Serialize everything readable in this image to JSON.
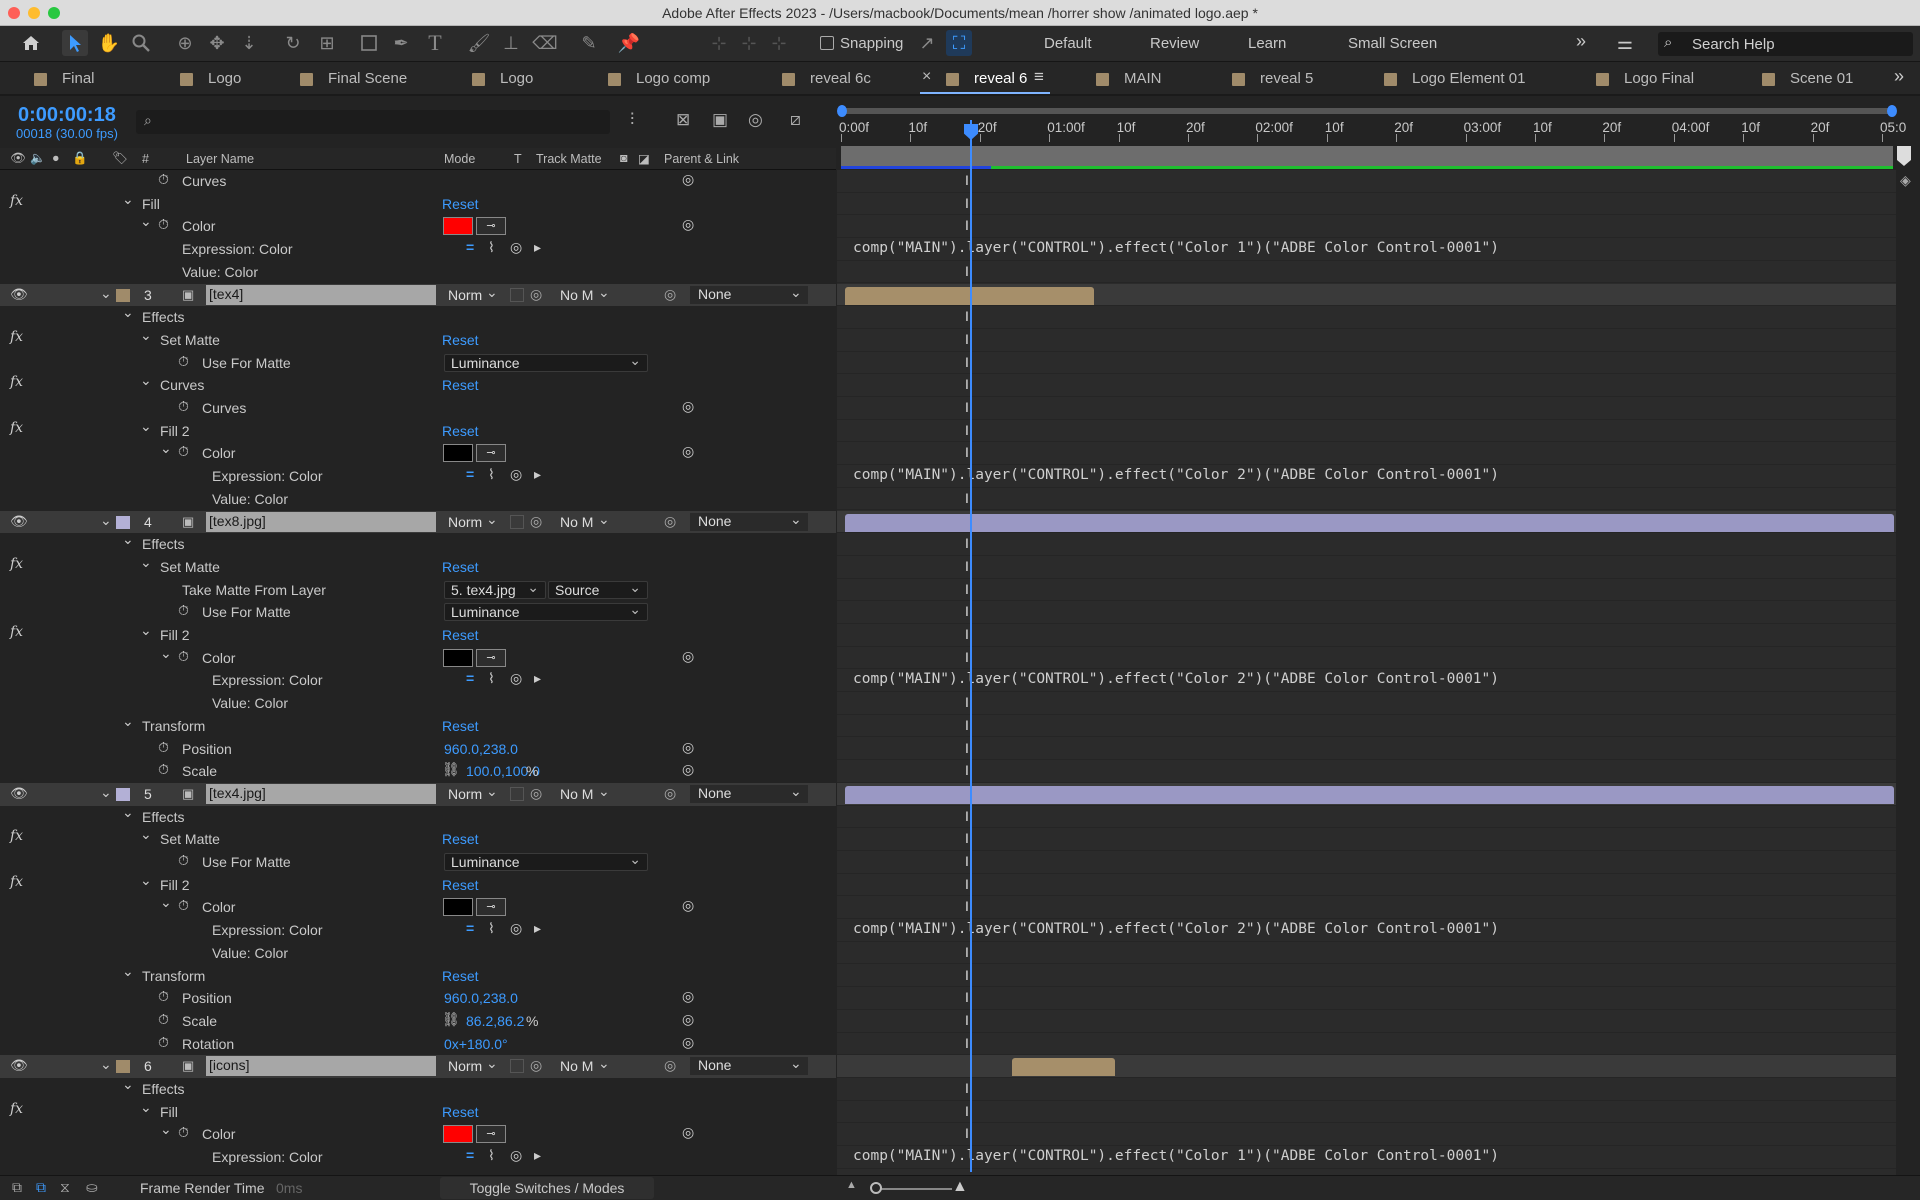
{
  "window": {
    "title": "Adobe After Effects 2023 - /Users/macbook/Documents/mean /horrer show /animated logo.aep *"
  },
  "toolbar": {
    "snapping_label": "Snapping",
    "workspaces": [
      "Default",
      "Review",
      "Learn",
      "Small Screen"
    ],
    "search_placeholder": "Search Help"
  },
  "tabs": [
    {
      "label": "Final"
    },
    {
      "label": "Logo"
    },
    {
      "label": "Final Scene"
    },
    {
      "label": "Logo"
    },
    {
      "label": "Logo comp"
    },
    {
      "label": "reveal 6c"
    },
    {
      "label": "reveal 6",
      "active": true
    },
    {
      "label": "MAIN"
    },
    {
      "label": "reveal 5"
    },
    {
      "label": "Logo Element 01"
    },
    {
      "label": "Logo Final"
    },
    {
      "label": "Scene 01"
    }
  ],
  "comp": {
    "timecode": "0:00:00:18",
    "frame_info": "00018 (30.00 fps)"
  },
  "columns": {
    "num": "#",
    "layer_name": "Layer Name",
    "mode": "Mode",
    "t": "T",
    "track_matte": "Track Matte",
    "parent": "Parent & Link"
  },
  "ruler": {
    "ticks": [
      "0:00f",
      "10f",
      "20f",
      "01:00f",
      "10f",
      "20f",
      "02:00f",
      "10f",
      "20f",
      "03:00f",
      "10f",
      "20f",
      "04:00f",
      "10f",
      "20f",
      "05:0"
    ]
  },
  "rows": [
    {
      "type": "prop",
      "indent": 2,
      "label": "Curves",
      "sw": true
    },
    {
      "type": "effect",
      "indent": 1,
      "label": "Fill",
      "reset": "Reset",
      "fx": true
    },
    {
      "type": "color",
      "indent": 2,
      "label": "Color",
      "swatch": "#ff0000",
      "sw": true
    },
    {
      "type": "expr",
      "indent": 3,
      "label": "Expression: Color",
      "expr": "comp(\"MAIN\").layer(\"CONTROL\").effect(\"Color 1\")(\"ADBE Color Control-0001\")"
    },
    {
      "type": "plain",
      "indent": 3,
      "label": "Value: Color"
    },
    {
      "type": "layer",
      "num": "3",
      "name": "[tex4]",
      "label_color": "#a08b6a",
      "mode": "Norm",
      "matte": "No M",
      "parent": "None",
      "bar": {
        "start": 0,
        "end": 0.237,
        "color": "#a68f6a"
      }
    },
    {
      "type": "group",
      "indent": 1,
      "label": "Effects"
    },
    {
      "type": "effect",
      "indent": 2,
      "label": "Set Matte",
      "reset": "Reset",
      "fx": true
    },
    {
      "type": "dd",
      "indent": 3,
      "label": "Use For Matte",
      "value": "Luminance"
    },
    {
      "type": "effect",
      "indent": 2,
      "label": "Curves",
      "reset": "Reset",
      "fx": true
    },
    {
      "type": "prop",
      "indent": 3,
      "label": "Curves",
      "sw": true
    },
    {
      "type": "effect",
      "indent": 2,
      "label": "Fill 2",
      "reset": "Reset",
      "fx": true
    },
    {
      "type": "color",
      "indent": 3,
      "label": "Color",
      "swatch": "#000000",
      "sw": true
    },
    {
      "type": "expr",
      "indent": 4,
      "label": "Expression: Color",
      "expr": "comp(\"MAIN\").layer(\"CONTROL\").effect(\"Color 2\")(\"ADBE Color Control-0001\")"
    },
    {
      "type": "plain",
      "indent": 4,
      "label": "Value: Color"
    },
    {
      "type": "layer",
      "num": "4",
      "name": "[tex8.jpg]",
      "label_color": "#b3b0d6",
      "mode": "Norm",
      "matte": "No M",
      "parent": "None",
      "bar": {
        "start": 0,
        "end": 1,
        "color": "#9a98c4"
      }
    },
    {
      "type": "group",
      "indent": 1,
      "label": "Effects"
    },
    {
      "type": "effect",
      "indent": 2,
      "label": "Set Matte",
      "reset": "Reset",
      "fx": true
    },
    {
      "type": "dd2",
      "indent": 3,
      "label": "Take Matte From Layer",
      "value": "5. tex4.jpg",
      "value2": "Source"
    },
    {
      "type": "dd",
      "indent": 3,
      "label": "Use For Matte",
      "value": "Luminance"
    },
    {
      "type": "effect",
      "indent": 2,
      "label": "Fill 2",
      "reset": "Reset",
      "fx": true
    },
    {
      "type": "color",
      "indent": 3,
      "label": "Color",
      "swatch": "#000000",
      "sw": true
    },
    {
      "type": "expr",
      "indent": 4,
      "label": "Expression: Color",
      "expr": "comp(\"MAIN\").layer(\"CONTROL\").effect(\"Color 2\")(\"ADBE Color Control-0001\")"
    },
    {
      "type": "plain",
      "indent": 4,
      "label": "Value: Color"
    },
    {
      "type": "group",
      "indent": 1,
      "label": "Transform",
      "reset": "Reset"
    },
    {
      "type": "val",
      "indent": 2,
      "label": "Position",
      "value": "960.0,238.0",
      "sw": true
    },
    {
      "type": "scale",
      "indent": 2,
      "label": "Scale",
      "value": "100.0,100.0",
      "unit": "%",
      "sw": true
    },
    {
      "type": "layer",
      "num": "5",
      "name": "[tex4.jpg]",
      "label_color": "#b3b0d6",
      "mode": "Norm",
      "matte": "No M",
      "parent": "None",
      "bar": {
        "start": 0,
        "end": 1,
        "color": "#9a98c4"
      }
    },
    {
      "type": "group",
      "indent": 1,
      "label": "Effects"
    },
    {
      "type": "effect",
      "indent": 2,
      "label": "Set Matte",
      "reset": "Reset",
      "fx": true
    },
    {
      "type": "dd",
      "indent": 3,
      "label": "Use For Matte",
      "value": "Luminance"
    },
    {
      "type": "effect",
      "indent": 2,
      "label": "Fill 2",
      "reset": "Reset",
      "fx": true
    },
    {
      "type": "color",
      "indent": 3,
      "label": "Color",
      "swatch": "#000000",
      "sw": true
    },
    {
      "type": "expr",
      "indent": 4,
      "label": "Expression: Color",
      "expr": "comp(\"MAIN\").layer(\"CONTROL\").effect(\"Color 2\")(\"ADBE Color Control-0001\")"
    },
    {
      "type": "plain",
      "indent": 4,
      "label": "Value: Color"
    },
    {
      "type": "group",
      "indent": 1,
      "label": "Transform",
      "reset": "Reset"
    },
    {
      "type": "val",
      "indent": 2,
      "label": "Position",
      "value": "960.0,238.0",
      "sw": true
    },
    {
      "type": "scale",
      "indent": 2,
      "label": "Scale",
      "value": "86.2,86.2",
      "unit": "%",
      "sw": true
    },
    {
      "type": "val",
      "indent": 2,
      "label": "Rotation",
      "value": "0x+180.0°",
      "sw": true
    },
    {
      "type": "layer",
      "num": "6",
      "name": "[icons]",
      "label_color": "#a08b6a",
      "mode": "Norm",
      "matte": "No M",
      "parent": "None",
      "bar": {
        "start": 0.159,
        "end": 0.257,
        "color": "#a68f6a"
      }
    },
    {
      "type": "group",
      "indent": 1,
      "label": "Effects"
    },
    {
      "type": "effect",
      "indent": 2,
      "label": "Fill",
      "reset": "Reset",
      "fx": true
    },
    {
      "type": "color",
      "indent": 3,
      "label": "Color",
      "swatch": "#ff0000",
      "sw": true
    },
    {
      "type": "expr",
      "indent": 4,
      "label": "Expression: Color",
      "expr": "comp(\"MAIN\").layer(\"CONTROL\").effect(\"Color 1\")(\"ADBE Color Control-0001\")"
    }
  ],
  "status": {
    "frame_render_label": "Frame Render Time",
    "frame_render_value": "0ms",
    "toggle_label": "Toggle Switches / Modes"
  },
  "colors": {
    "accent": "#3d9bff",
    "panel": "#2b2b2b"
  }
}
